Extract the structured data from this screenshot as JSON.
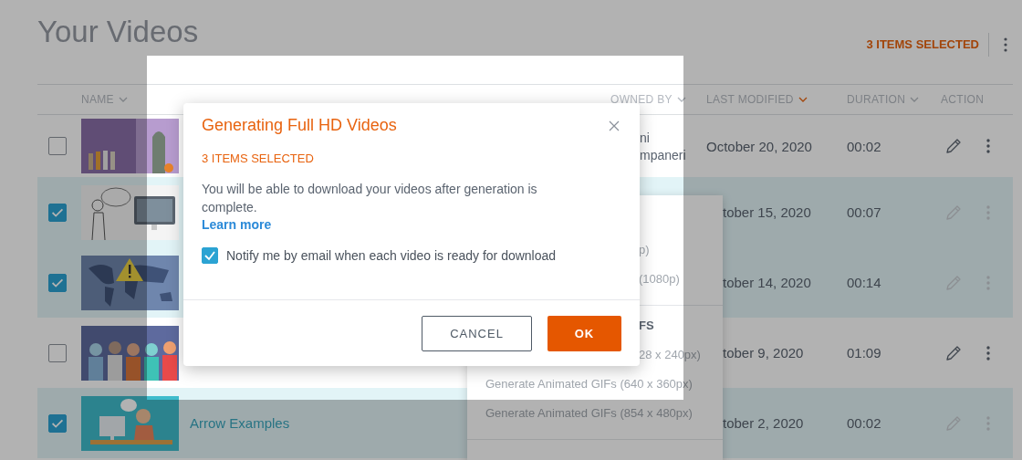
{
  "page": {
    "title": "Your Videos",
    "selection_count": "3 ITEMS SELECTED"
  },
  "table": {
    "columns": [
      {
        "label": "NAME",
        "kind": "sortable",
        "sorted": false
      },
      {
        "label": "OWNED BY",
        "kind": "sortable",
        "sorted": false
      },
      {
        "label": "LAST MODIFIED",
        "kind": "sortable",
        "sorted": true
      },
      {
        "label": "DURATION",
        "kind": "sortable",
        "sorted": false
      },
      {
        "label": "ACTION",
        "kind": "plain"
      }
    ],
    "rows": [
      {
        "selected": false,
        "owner": [
          "ni",
          "mpaneri"
        ],
        "date": "October 20, 2020",
        "date_clipped": false,
        "duration": "00:02"
      },
      {
        "selected": true,
        "date": "tober 15, 2020",
        "date_clipped": true,
        "duration": "00:07"
      },
      {
        "selected": true,
        "date": "tober 14, 2020",
        "date_clipped": true,
        "duration": "00:14"
      },
      {
        "selected": false,
        "date": "tober 9, 2020",
        "date_clipped": true,
        "duration": "01:09"
      },
      {
        "selected": true,
        "name": "Arrow Examples",
        "date": "tober 2, 2020",
        "date_clipped": true,
        "duration": "00:02"
      }
    ]
  },
  "menu": {
    "items": [
      {
        "kind": "clipped",
        "label": "p)"
      },
      {
        "kind": "clipped",
        "label": "(1080p)"
      },
      {
        "kind": "divider"
      },
      {
        "kind": "clipped_header",
        "label": "FS"
      },
      {
        "kind": "clipped",
        "label": "28 x 240px)"
      },
      {
        "kind": "item",
        "label": "Generate Animated GIFs (640 x 360px)"
      },
      {
        "kind": "item",
        "label": "Generate Animated GIFs (854 x 480px)"
      },
      {
        "kind": "divider"
      }
    ]
  },
  "dialog": {
    "title": "Generating Full HD Videos",
    "count": "3 ITEMS SELECTED",
    "message": "You will be able to download your videos after generation is complete.",
    "link": "Learn more",
    "notify": {
      "label": "Notify me by email when each video is ready for download",
      "checked": true
    },
    "buttons": [
      {
        "label": "CANCEL",
        "kind": "secondary"
      },
      {
        "label": "OK",
        "kind": "primary"
      }
    ]
  }
}
